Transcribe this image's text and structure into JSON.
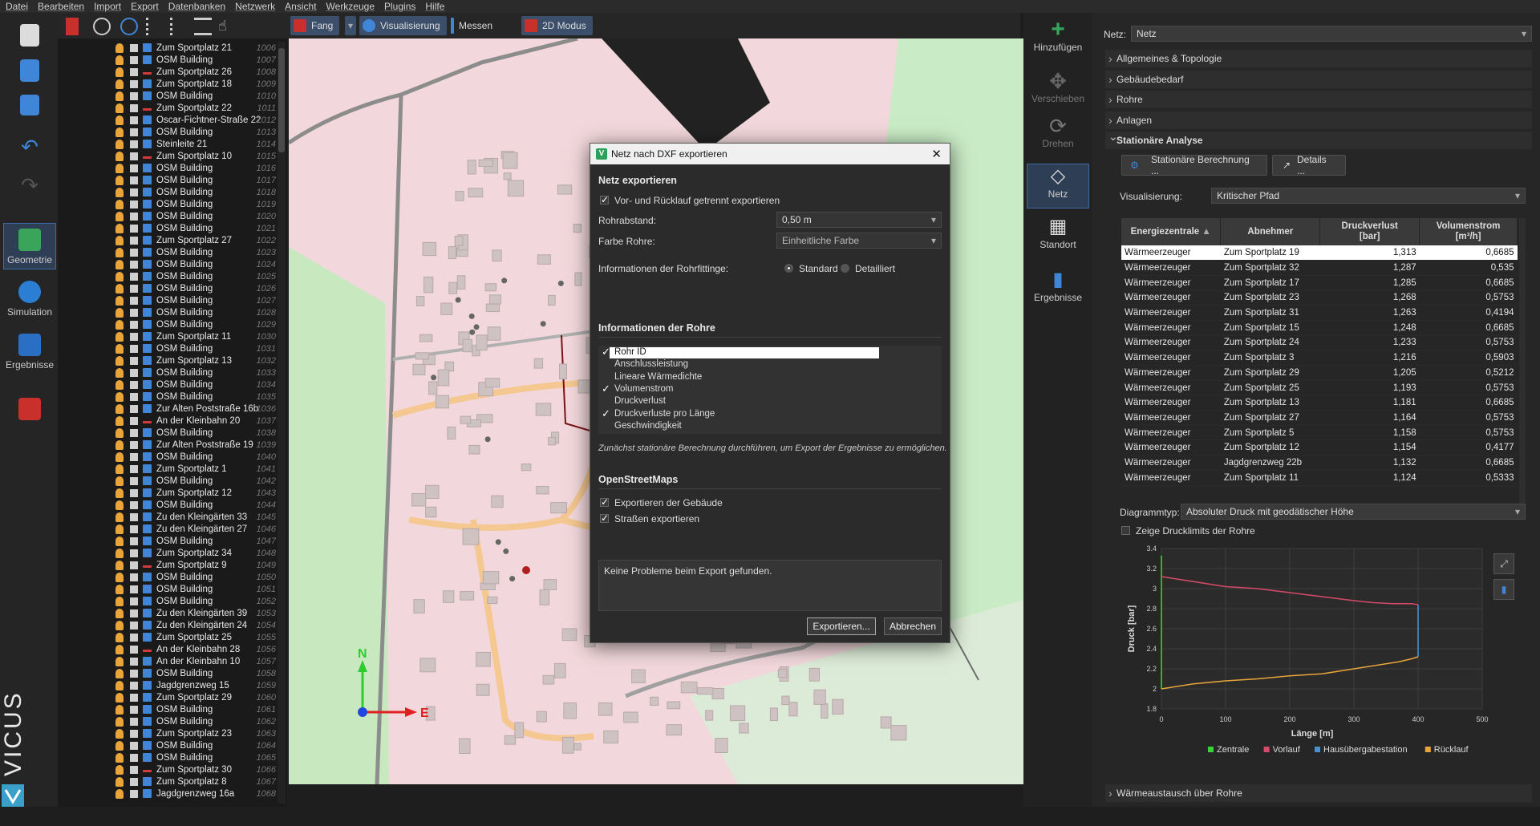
{
  "menu": [
    "Datei",
    "Bearbeiten",
    "Import",
    "Export",
    "Datenbanken",
    "Netzwerk",
    "Ansicht",
    "Werkzeuge",
    "Plugins",
    "Hilfe"
  ],
  "leftbar": {
    "geometrie": "Geometrie",
    "simulation": "Simulation",
    "ergebnisse": "Ergebnisse",
    "brand": "VICUS"
  },
  "toolbar2": {
    "fang": "Fang",
    "visualisierung": "Visualisierung",
    "messen": "Messen",
    "modus": "2D Modus"
  },
  "tree": [
    {
      "name": "Zum Sportplatz 21",
      "num": "1006",
      "type": "b"
    },
    {
      "name": "OSM Building",
      "num": "1007",
      "type": "b"
    },
    {
      "name": "Zum Sportplatz 26",
      "num": "1008",
      "type": "s"
    },
    {
      "name": "Zum Sportplatz 18",
      "num": "1009",
      "type": "b"
    },
    {
      "name": "OSM Building",
      "num": "1010",
      "type": "b"
    },
    {
      "name": "Zum Sportplatz 22",
      "num": "1011",
      "type": "s"
    },
    {
      "name": "Oscar-Fichtner-Straße 22",
      "num": "1012",
      "type": "b"
    },
    {
      "name": "OSM Building",
      "num": "1013",
      "type": "b"
    },
    {
      "name": "Steinleite 21",
      "num": "1014",
      "type": "b"
    },
    {
      "name": "Zum Sportplatz 10",
      "num": "1015",
      "type": "s"
    },
    {
      "name": "OSM Building",
      "num": "1016",
      "type": "b"
    },
    {
      "name": "OSM Building",
      "num": "1017",
      "type": "b"
    },
    {
      "name": "OSM Building",
      "num": "1018",
      "type": "b"
    },
    {
      "name": "OSM Building",
      "num": "1019",
      "type": "b"
    },
    {
      "name": "OSM Building",
      "num": "1020",
      "type": "b"
    },
    {
      "name": "OSM Building",
      "num": "1021",
      "type": "b"
    },
    {
      "name": "Zum Sportplatz 27",
      "num": "1022",
      "type": "b"
    },
    {
      "name": "OSM Building",
      "num": "1023",
      "type": "b"
    },
    {
      "name": "OSM Building",
      "num": "1024",
      "type": "b"
    },
    {
      "name": "OSM Building",
      "num": "1025",
      "type": "b"
    },
    {
      "name": "OSM Building",
      "num": "1026",
      "type": "b"
    },
    {
      "name": "OSM Building",
      "num": "1027",
      "type": "b"
    },
    {
      "name": "OSM Building",
      "num": "1028",
      "type": "b"
    },
    {
      "name": "OSM Building",
      "num": "1029",
      "type": "b"
    },
    {
      "name": "Zum Sportplatz 11",
      "num": "1030",
      "type": "b"
    },
    {
      "name": "OSM Building",
      "num": "1031",
      "type": "b"
    },
    {
      "name": "Zum Sportplatz 13",
      "num": "1032",
      "type": "b"
    },
    {
      "name": "OSM Building",
      "num": "1033",
      "type": "b"
    },
    {
      "name": "OSM Building",
      "num": "1034",
      "type": "b"
    },
    {
      "name": "OSM Building",
      "num": "1035",
      "type": "b"
    },
    {
      "name": "Zur Alten Poststraße 16b",
      "num": "1036",
      "type": "b"
    },
    {
      "name": "An der Kleinbahn 20",
      "num": "1037",
      "type": "s"
    },
    {
      "name": "OSM Building",
      "num": "1038",
      "type": "b"
    },
    {
      "name": "Zur Alten Poststraße 19",
      "num": "1039",
      "type": "b"
    },
    {
      "name": "OSM Building",
      "num": "1040",
      "type": "b"
    },
    {
      "name": "Zum Sportplatz 1",
      "num": "1041",
      "type": "b"
    },
    {
      "name": "OSM Building",
      "num": "1042",
      "type": "b"
    },
    {
      "name": "Zum Sportplatz 12",
      "num": "1043",
      "type": "b"
    },
    {
      "name": "OSM Building",
      "num": "1044",
      "type": "b"
    },
    {
      "name": "Zu den Kleingärten 33",
      "num": "1045",
      "type": "b"
    },
    {
      "name": "Zu den Kleingärten 27",
      "num": "1046",
      "type": "b"
    },
    {
      "name": "OSM Building",
      "num": "1047",
      "type": "b"
    },
    {
      "name": "Zum Sportplatz 34",
      "num": "1048",
      "type": "b"
    },
    {
      "name": "Zum Sportplatz 9",
      "num": "1049",
      "type": "s"
    },
    {
      "name": "OSM Building",
      "num": "1050",
      "type": "b"
    },
    {
      "name": "OSM Building",
      "num": "1051",
      "type": "b"
    },
    {
      "name": "OSM Building",
      "num": "1052",
      "type": "b"
    },
    {
      "name": "Zu den Kleingärten 39",
      "num": "1053",
      "type": "b"
    },
    {
      "name": "Zu den Kleingärten 24",
      "num": "1054",
      "type": "b"
    },
    {
      "name": "Zum Sportplatz 25",
      "num": "1055",
      "type": "b"
    },
    {
      "name": "An der Kleinbahn 28",
      "num": "1056",
      "type": "s"
    },
    {
      "name": "An der Kleinbahn 10",
      "num": "1057",
      "type": "b"
    },
    {
      "name": "OSM Building",
      "num": "1058",
      "type": "b"
    },
    {
      "name": "Jagdgrenzweg 15",
      "num": "1059",
      "type": "b"
    },
    {
      "name": "Zum Sportplatz 29",
      "num": "1060",
      "type": "b"
    },
    {
      "name": "OSM Building",
      "num": "1061",
      "type": "b"
    },
    {
      "name": "OSM Building",
      "num": "1062",
      "type": "b"
    },
    {
      "name": "Zum Sportplatz 23",
      "num": "1063",
      "type": "b"
    },
    {
      "name": "OSM Building",
      "num": "1064",
      "type": "b"
    },
    {
      "name": "OSM Building",
      "num": "1065",
      "type": "b"
    },
    {
      "name": "Zum Sportplatz 30",
      "num": "1066",
      "type": "s"
    },
    {
      "name": "Zum Sportplatz 8",
      "num": "1067",
      "type": "b"
    },
    {
      "name": "Jagdgrenzweg 16a",
      "num": "1068",
      "type": "b"
    }
  ],
  "map": {
    "north": "N",
    "east": "E"
  },
  "rightbar": {
    "add": "Hinzufügen",
    "move": "Verschieben",
    "rotate": "Drehen",
    "network": "Netz",
    "location": "Standort",
    "results": "Ergebnisse"
  },
  "panel": {
    "netz_label": "Netz:",
    "netz_value": "Netz",
    "sections": [
      "Allgemeines & Topologie",
      "Gebäudebedarf",
      "Rohre",
      "Anlagen"
    ],
    "analysis_title": "Stationäre Analyse",
    "calc_button": "Stationäre Berechnung ...",
    "details_button": "Details ...",
    "vis_label": "Visualisierung:",
    "vis_value": "Kritischer Pfad",
    "table_headers": [
      "Energiezentrale",
      "Abnehmer",
      "Druckverlust\n[bar]",
      "Volumenstrom\n[m³/h]"
    ],
    "rows": [
      [
        "Wärmeerzeuger",
        "Zum Sportplatz 19",
        "1,313",
        "0,6685"
      ],
      [
        "Wärmeerzeuger",
        "Zum Sportplatz 32",
        "1,287",
        "0,535"
      ],
      [
        "Wärmeerzeuger",
        "Zum Sportplatz 17",
        "1,285",
        "0,6685"
      ],
      [
        "Wärmeerzeuger",
        "Zum Sportplatz 23",
        "1,268",
        "0,5753"
      ],
      [
        "Wärmeerzeuger",
        "Zum Sportplatz 31",
        "1,263",
        "0,4194"
      ],
      [
        "Wärmeerzeuger",
        "Zum Sportplatz 15",
        "1,248",
        "0,6685"
      ],
      [
        "Wärmeerzeuger",
        "Zum Sportplatz 24",
        "1,233",
        "0,5753"
      ],
      [
        "Wärmeerzeuger",
        "Zum Sportplatz 3",
        "1,216",
        "0,5903"
      ],
      [
        "Wärmeerzeuger",
        "Zum Sportplatz 29",
        "1,205",
        "0,5212"
      ],
      [
        "Wärmeerzeuger",
        "Zum Sportplatz 25",
        "1,193",
        "0,5753"
      ],
      [
        "Wärmeerzeuger",
        "Zum Sportplatz 13",
        "1,181",
        "0,6685"
      ],
      [
        "Wärmeerzeuger",
        "Zum Sportplatz 27",
        "1,164",
        "0,5753"
      ],
      [
        "Wärmeerzeuger",
        "Zum Sportplatz 5",
        "1,158",
        "0,5753"
      ],
      [
        "Wärmeerzeuger",
        "Zum Sportplatz 12",
        "1,154",
        "0,4177"
      ],
      [
        "Wärmeerzeuger",
        "Jagdgrenzweg 22b",
        "1,132",
        "0,6685"
      ],
      [
        "Wärmeerzeuger",
        "Zum Sportplatz 11",
        "1,124",
        "0,5333"
      ]
    ],
    "diag_label": "Diagrammtyp:",
    "diag_value": "Absoluter Druck mit geodätischer Höhe",
    "limits_label": "Zeige Drucklimits der Rohre",
    "bottom_section": "Wärmeaustausch über Rohre"
  },
  "chart_data": {
    "type": "line",
    "xlabel": "Länge [m]",
    "ylabel": "Druck [bar]",
    "xlim": [
      0,
      500
    ],
    "ylim": [
      1.8,
      3.4
    ],
    "xticks": [
      "0",
      "100",
      "200",
      "300",
      "400",
      "500"
    ],
    "yticks": [
      "1.8",
      "2",
      "2.2",
      "2.4",
      "2.6",
      "2.8",
      "3",
      "3.2",
      "3.4"
    ],
    "series": [
      {
        "name": "Zentrale",
        "color": "#3bd13b",
        "x": [
          0,
          0
        ],
        "y": [
          2.0,
          3.33
        ]
      },
      {
        "name": "Vorlauf",
        "color": "#d64a6a",
        "x": [
          0,
          20,
          60,
          100,
          150,
          200,
          250,
          300,
          330,
          360,
          390,
          400
        ],
        "y": [
          3.12,
          3.1,
          3.06,
          3.02,
          3.0,
          2.96,
          2.92,
          2.88,
          2.86,
          2.85,
          2.85,
          2.84
        ]
      },
      {
        "name": "Hausübergabestation",
        "color": "#4a8fd6",
        "x": [
          400,
          400
        ],
        "y": [
          2.84,
          2.32
        ]
      },
      {
        "name": "Rücklauf",
        "color": "#e8a53a",
        "x": [
          0,
          50,
          100,
          150,
          200,
          250,
          300,
          340,
          370,
          390,
          400
        ],
        "y": [
          2.0,
          2.05,
          2.08,
          2.1,
          2.13,
          2.15,
          2.2,
          2.24,
          2.27,
          2.3,
          2.32
        ]
      }
    ],
    "legend": "bottom"
  },
  "dialog": {
    "title": "Netz nach DXF exportieren",
    "h1": "Netz exportieren",
    "sep_chk": "Vor- und Rücklauf getrennt exportieren",
    "rohrabstand_label": "Rohrabstand:",
    "rohrabstand_value": "0,50 m",
    "farbe_label": "Farbe Rohre:",
    "farbe_value": "Einheitliche Farbe",
    "fitt_label": "Informationen der Rohrfittinge:",
    "opt_standard": "Standard",
    "opt_detail": "Detailliert",
    "h2": "Informationen der Rohre",
    "rohr_items": [
      {
        "label": "Rohr ID",
        "checked": true
      },
      {
        "label": "Anschlussleistung",
        "checked": false
      },
      {
        "label": "Lineare Wärmedichte",
        "checked": false
      },
      {
        "label": "Volumenstrom",
        "checked": true
      },
      {
        "label": "Druckverlust",
        "checked": false
      },
      {
        "label": "Druckverluste pro Länge",
        "checked": true
      },
      {
        "label": "Geschwindigkeit",
        "checked": false
      }
    ],
    "hint": "Zunächst stationäre Berechnung durchführen, um Export der Ergebnisse zu ermöglichen.",
    "h3": "OpenStreetMaps",
    "osm_buildings": "Exportieren der Gebäude",
    "osm_streets": "Straßen exportieren",
    "status": "Keine Probleme beim Export gefunden.",
    "export_btn": "Exportieren...",
    "cancel_btn": "Abbrechen"
  }
}
